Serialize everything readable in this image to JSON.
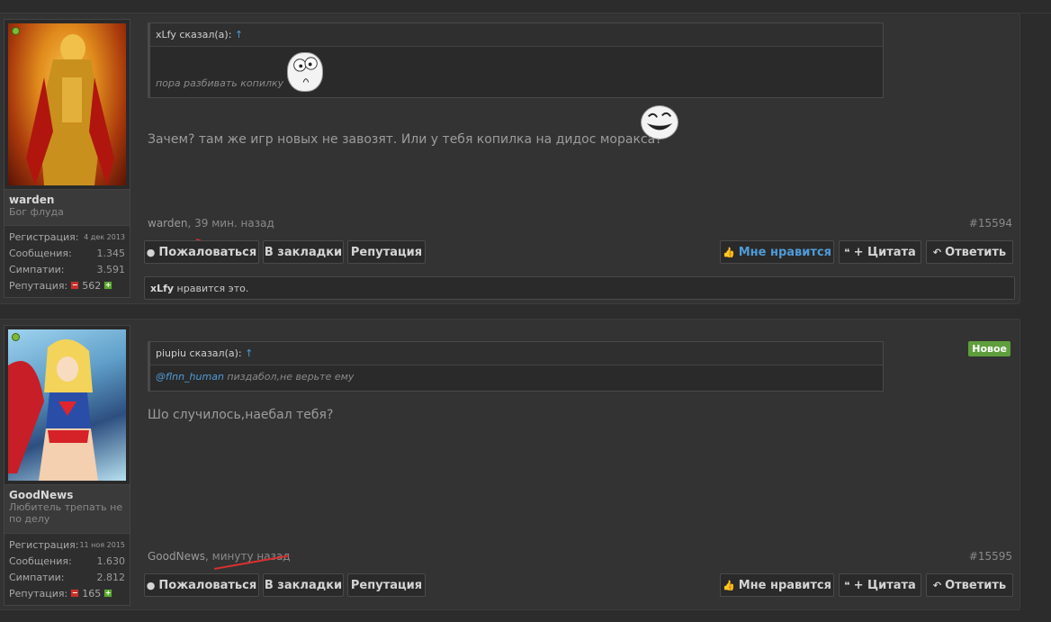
{
  "posts": [
    {
      "user": {
        "name": "warden",
        "title": "Бог флуда",
        "stats": [
          {
            "label": "Регистрация:",
            "value": "4 дек 2013"
          },
          {
            "label": "Сообщения:",
            "value": "1.345"
          },
          {
            "label": "Симпатии:",
            "value": "3.591"
          }
        ],
        "reputation_label": "Репутация:",
        "reputation_value": "562"
      },
      "quote": {
        "author": "xLfy сказал(а):",
        "arrow": "↑",
        "text": "пора разбивать копилку"
      },
      "message": "Зачем? там же игр новых не завозят. Или у тебя копилка на дидос моракса?",
      "meta_author": "warden",
      "meta_time": ", 39 мин. назад",
      "post_number": "#15594",
      "likes_user": "xLfy",
      "likes_text": " нравится это."
    },
    {
      "user": {
        "name": "GoodNews",
        "title": "Любитель трепать не по делу",
        "stats": [
          {
            "label": "Регистрация:",
            "value": "11 ноя 2015"
          },
          {
            "label": "Сообщения:",
            "value": "1.630"
          },
          {
            "label": "Симпатии:",
            "value": "2.812"
          }
        ],
        "reputation_label": "Репутация:",
        "reputation_value": "165"
      },
      "badge": "Новое",
      "quote": {
        "author": "piupiu сказал(а):",
        "arrow": "↑",
        "mention": "@flnn_human",
        "text": " пиздабол,не верьте ему"
      },
      "message": "Шо случилось,наебал тебя?",
      "meta_author": "GoodNews",
      "meta_time": ", минуту назад",
      "post_number": "#15595"
    }
  ],
  "buttons": {
    "report": "Пожаловаться",
    "bookmark": "В закладки",
    "reputation": "Репутация",
    "like": "Мне нравится",
    "quote": "+ Цитата",
    "reply": "Ответить"
  },
  "rep_minus": "−",
  "rep_plus": "+",
  "icons": {
    "report": "alert-circle-icon",
    "like": "thumbs-up-icon",
    "quote": "quote-icon",
    "reply": "reply-arrow-icon"
  },
  "colors": {
    "link": "#4f9bd8",
    "badge": "#5f9e3c",
    "online": "#7dbb37"
  }
}
